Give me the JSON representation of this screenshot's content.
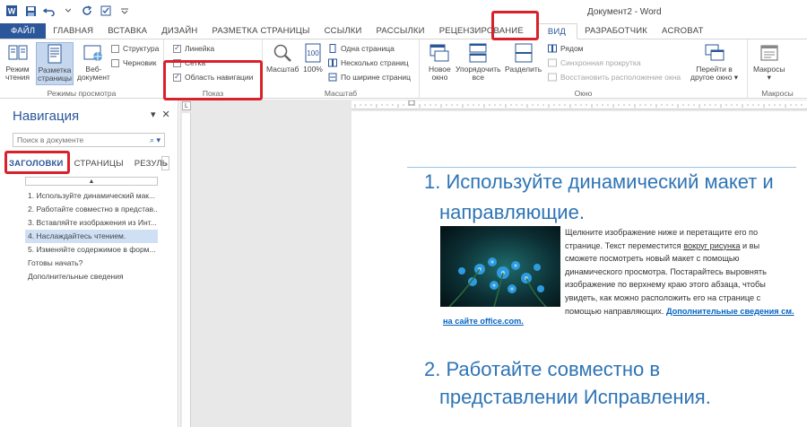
{
  "window": {
    "title": "Документ2 - Word"
  },
  "qat": {
    "icons": [
      "word-logo-icon",
      "save-icon",
      "undo-icon",
      "redo-icon",
      "checkbox-icon",
      "customize-qat-icon"
    ]
  },
  "tabs": [
    {
      "label": "ФАЙЛ",
      "kind": "file"
    },
    {
      "label": "ГЛАВНАЯ"
    },
    {
      "label": "ВСТАВКА"
    },
    {
      "label": "ДИЗАЙН"
    },
    {
      "label": "РАЗМЕТКА СТРАНИЦЫ"
    },
    {
      "label": "ССЫЛКИ"
    },
    {
      "label": "РАССЫЛКИ"
    },
    {
      "label": "РЕЦЕНЗИРОВАНИЕ"
    },
    {
      "label": "ВИД",
      "kind": "active"
    },
    {
      "label": "РАЗРАБОТЧИК"
    },
    {
      "label": "ACROBAT"
    }
  ],
  "ribbon": {
    "views": {
      "label": "Режимы просмотра",
      "read": "Режим\nчтения",
      "layout": "Разметка\nстраницы",
      "web": "Веб-\nдокумент",
      "outline": "Структура",
      "draft": "Черновик"
    },
    "show": {
      "label": "Показ",
      "ruler": "Линейка",
      "grid": "Сетка",
      "navpane": "Область навигации",
      "checked": "✓"
    },
    "zoom": {
      "label": "Масштаб",
      "zoom": "Масштаб",
      "pct": "100%",
      "one_page": "Одна страница",
      "multi_page": "Несколько страниц",
      "page_width": "По ширине страниц"
    },
    "window": {
      "label": "Окно",
      "new_window": "Новое\nокно",
      "arrange_all": "Упорядочить\nвсе",
      "split": "Разделить",
      "side_by_side": "Рядом",
      "sync_scroll": "Синхронная прокрутка",
      "reset_pos": "Восстановить расположение окна",
      "switch": "Перейти в\nдругое окно ▾"
    },
    "macros": {
      "label": "Макросы",
      "button": "Макросы\n▾"
    }
  },
  "nav": {
    "title": "Навигация",
    "menu_glyph": "▾",
    "close_glyph": "✕",
    "search_placeholder": "Поиск в документе",
    "search_glyph": "⌕ ▾",
    "tabs": [
      "ЗАГОЛОВКИ",
      "СТРАНИЦЫ",
      "РЕЗУЛЬ"
    ],
    "scroll_glyph": "›",
    "collapse_glyph": "▲",
    "items": [
      "1. Используйте динамический мак...",
      "2. Работайте совместно в представ...",
      "3. Вставляйте изображения из Инт...",
      "4. Наслаждайтесь чтением.",
      "5. Изменяйте содержимое в форм...",
      "Готовы начать?",
      "Дополнительные сведения"
    ],
    "selected_index": 3
  },
  "ruler": {
    "corner": "L"
  },
  "document": {
    "h1_line1": "1. Используйте динамический макет и",
    "h1_line2": "направляющие.",
    "para_lines": [
      "Щелкните изображение ниже и перетащите его по",
      "странице. Текст переместится ",
      "сможете посмотреть новый макет с помощью",
      "динамического просмотра. Постарайтесь выровнять",
      "изображение по верхнему краю этого абзаца, чтобы",
      "увидеть, как можно расположить его на странице с",
      "помощью направляющих. "
    ],
    "underlined_phrase": "вокруг рисунка",
    "after_underline": " и вы",
    "link_text": "Дополнительные сведения см.",
    "link_tail": "на сайте office.com.",
    "h2_line1": "2. Работайте совместно в",
    "h2_line2": "представлении Исправления."
  },
  "colors": {
    "accent": "#2b579a",
    "heading": "#2e74b5",
    "highlight": "#d9212c",
    "link": "#0563c1"
  }
}
